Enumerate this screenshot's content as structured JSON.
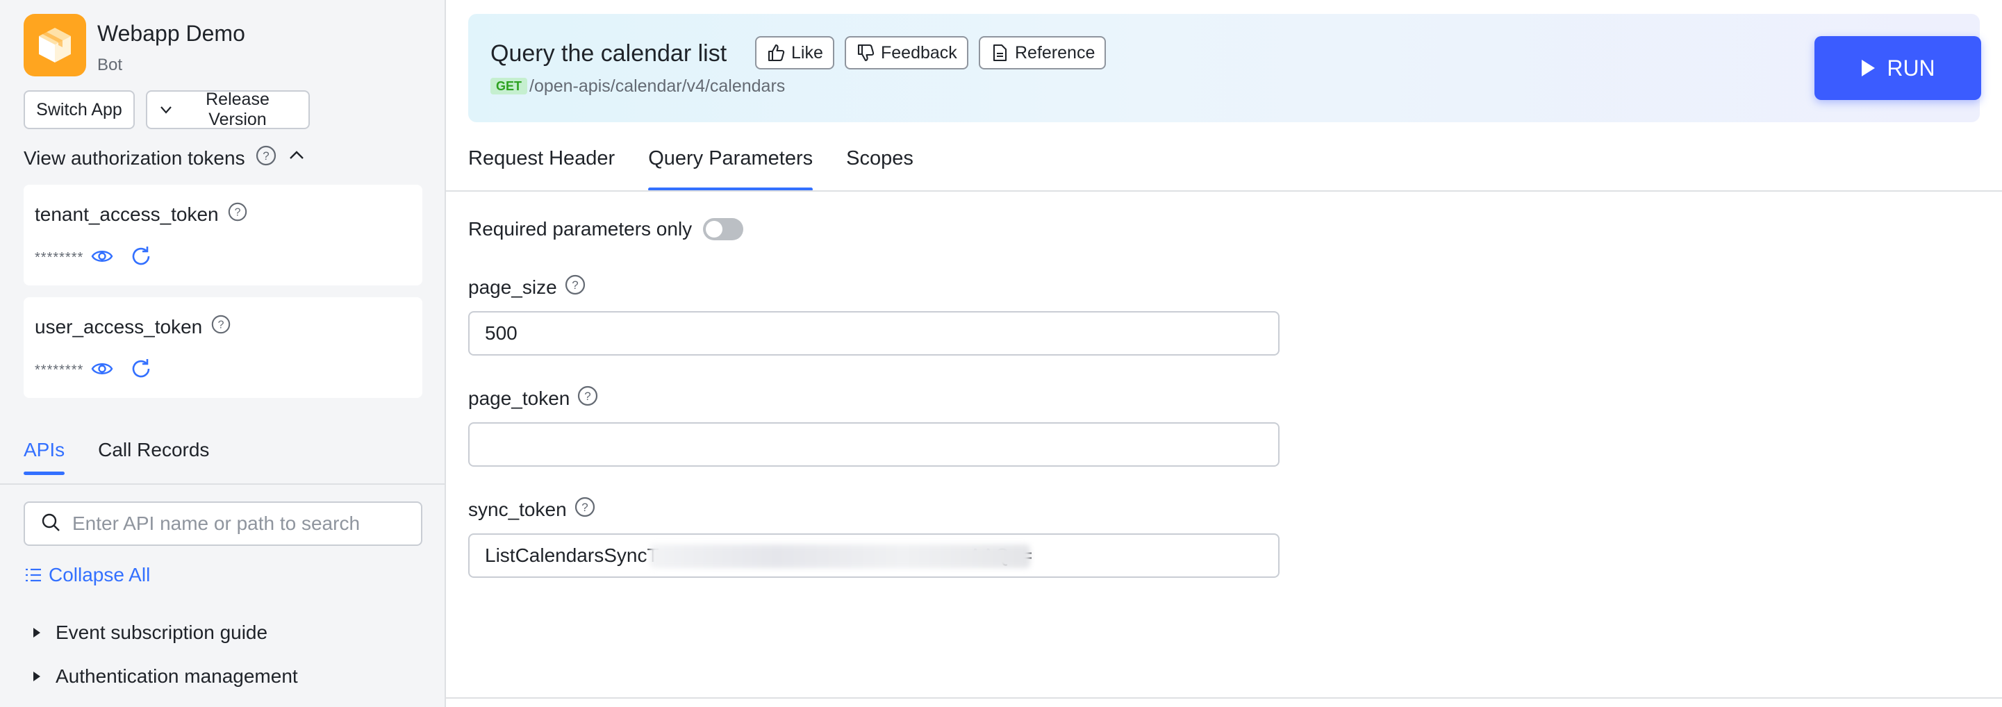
{
  "app": {
    "name": "Webapp Demo",
    "type": "Bot",
    "switch_label": "Switch App",
    "release_label": "Release Version"
  },
  "auth": {
    "toggle_label": "View authorization tokens",
    "tokens": [
      {
        "name": "tenant_access_token",
        "masked": "********"
      },
      {
        "name": "user_access_token",
        "masked": "********"
      }
    ]
  },
  "sidebar": {
    "tabs": [
      {
        "label": "APIs",
        "active": true
      },
      {
        "label": "Call Records",
        "active": false
      }
    ],
    "search_placeholder": "Enter API name or path to search",
    "collapse_label": "Collapse All",
    "tree": [
      {
        "label": "Event subscription guide"
      },
      {
        "label": "Authentication management"
      }
    ]
  },
  "header": {
    "title": "Query the calendar list",
    "like_label": "Like",
    "feedback_label": "Feedback",
    "reference_label": "Reference",
    "method": "GET",
    "path": "/open-apis/calendar/v4/calendars",
    "run_label": "RUN"
  },
  "main_tabs": [
    {
      "label": "Request Header",
      "active": false
    },
    {
      "label": "Query Parameters",
      "active": true
    },
    {
      "label": "Scopes",
      "active": false
    }
  ],
  "params": {
    "required_only_label": "Required parameters only",
    "required_only_on": false,
    "fields": [
      {
        "name": "page_size",
        "value": "500"
      },
      {
        "name": "page_token",
        "value": ""
      },
      {
        "name": "sync_token",
        "value": "ListCalendarsSyncT                                                    cxxAAQ=="
      }
    ]
  },
  "colors": {
    "accent": "#3370ff",
    "run_button": "#3b5cff",
    "app_logo": "#ffa51f",
    "get_badge_bg": "#c5efcf",
    "get_badge_text": "#2ea121"
  }
}
